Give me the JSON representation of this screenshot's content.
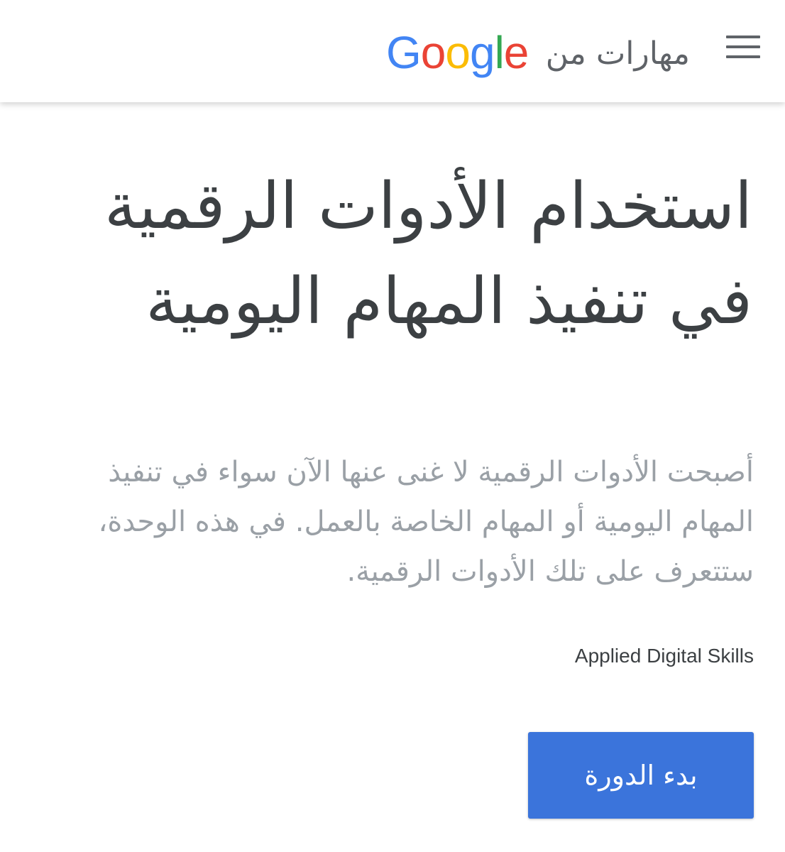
{
  "header": {
    "menu_icon": "hamburger-menu-icon",
    "brand_logo_text": "Google",
    "brand_text": "مهارات من",
    "logo_colors": [
      "#4285F4",
      "#EA4335",
      "#FBBC05",
      "#4285F4",
      "#34A853",
      "#EA4335"
    ]
  },
  "main": {
    "title": "استخدام الأدوات الرقمية في تنفيذ المهام اليومية",
    "description": "أصبحت الأدوات الرقمية لا غنى عنها الآن سواء في تنفيذ المهام اليومية أو المهام الخاصة بالعمل. في هذه الوحدة، ستتعرف على تلك الأدوات الرقمية.",
    "provider": "Applied Digital Skills",
    "start_button_label": "بدء الدورة",
    "accent_color": "#3b74db"
  }
}
